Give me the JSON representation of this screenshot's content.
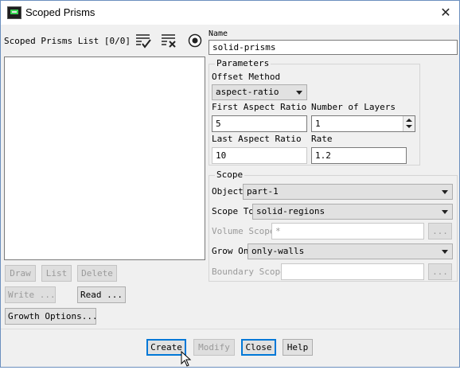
{
  "window": {
    "title": "Scoped Prisms",
    "close_glyph": "✕"
  },
  "left": {
    "list_label": "Scoped Prisms List [0/0]",
    "icons": [
      "select-all-icon",
      "deselect-all-icon",
      "radio-target-icon"
    ],
    "buttons": {
      "draw": "Draw",
      "list": "List",
      "delete": "Delete",
      "write": "Write ...",
      "read": "Read ...",
      "growth_options": "Growth Options..."
    }
  },
  "name": {
    "label": "Name",
    "value": "solid-prisms"
  },
  "parameters": {
    "title": "Parameters",
    "offset_method_label": "Offset Method",
    "offset_method_value": "aspect-ratio",
    "first_aspect_ratio_label": "First Aspect Ratio",
    "first_aspect_ratio_value": "5",
    "number_of_layers_label": "Number of Layers",
    "number_of_layers_value": "1",
    "last_aspect_ratio_label": "Last Aspect Ratio",
    "last_aspect_ratio_value": "10",
    "rate_label": "Rate",
    "rate_value": "1.2"
  },
  "scope": {
    "title": "Scope",
    "object_label": "Object",
    "object_value": "part-1",
    "scope_to_label": "Scope To",
    "scope_to_value": "solid-regions",
    "volume_scope_label": "Volume Scope",
    "volume_scope_value": "*",
    "grow_on_label": "Grow On",
    "grow_on_value": "only-walls",
    "boundary_scope_label": "Boundary Scope",
    "boundary_scope_value": "",
    "browse_label": "..."
  },
  "footer": {
    "create": "Create",
    "modify": "Modify",
    "close": "Close",
    "help": "Help"
  }
}
